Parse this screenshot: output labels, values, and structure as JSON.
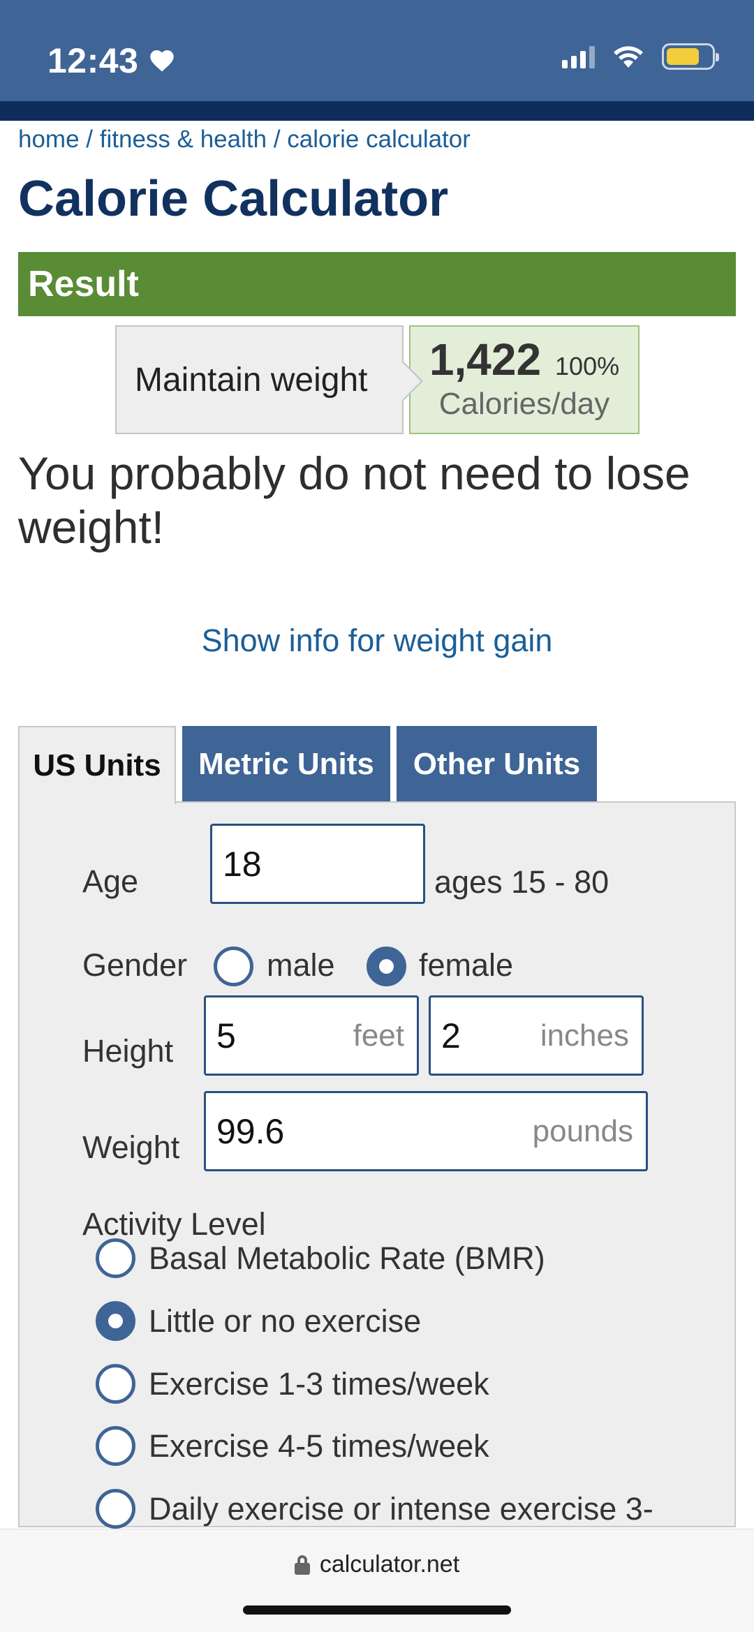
{
  "status_bar": {
    "time": "12:43",
    "icons": [
      "heart-icon",
      "signal-icon",
      "wifi-icon",
      "battery-icon"
    ],
    "battery_color": "#f2cd3c"
  },
  "breadcrumb": {
    "home": "home",
    "category": "fitness & health",
    "current": "calorie calculator",
    "separator": "/"
  },
  "page_title": "Calorie Calculator",
  "result": {
    "header": "Result",
    "goal_label": "Maintain weight",
    "calories": "1,422",
    "percent": "100%",
    "unit": "Calories/day",
    "message": "You probably do not need to lose weight!",
    "weight_gain_link": "Show info for weight gain"
  },
  "tabs": [
    {
      "label": "US Units",
      "active": true
    },
    {
      "label": "Metric Units",
      "active": false
    },
    {
      "label": "Other Units",
      "active": false
    }
  ],
  "form": {
    "age": {
      "label": "Age",
      "value": "18",
      "hint": "ages 15 - 80"
    },
    "gender": {
      "label": "Gender",
      "options": [
        {
          "label": "male",
          "selected": false
        },
        {
          "label": "female",
          "selected": true
        }
      ]
    },
    "height": {
      "label": "Height",
      "feet_value": "5",
      "feet_unit": "feet",
      "inches_value": "2",
      "inches_unit": "inches"
    },
    "weight": {
      "label": "Weight",
      "value": "99.6",
      "unit": "pounds"
    },
    "activity": {
      "label": "Activity Level",
      "options": [
        {
          "label": "Basal Metabolic Rate (BMR)",
          "selected": false
        },
        {
          "label": "Little or no exercise",
          "selected": true
        },
        {
          "label": "Exercise 1-3 times/week",
          "selected": false
        },
        {
          "label": "Exercise 4-5 times/week",
          "selected": false
        },
        {
          "label": "Daily exercise or intense exercise 3-",
          "selected": false
        }
      ]
    }
  },
  "browser": {
    "url": "calculator.net"
  },
  "colors": {
    "header_blue": "#3f6496",
    "nav_dark": "#0f2d5a",
    "title_navy": "#11325f",
    "result_green": "#5a8b35",
    "link_blue": "#1b5e96"
  }
}
